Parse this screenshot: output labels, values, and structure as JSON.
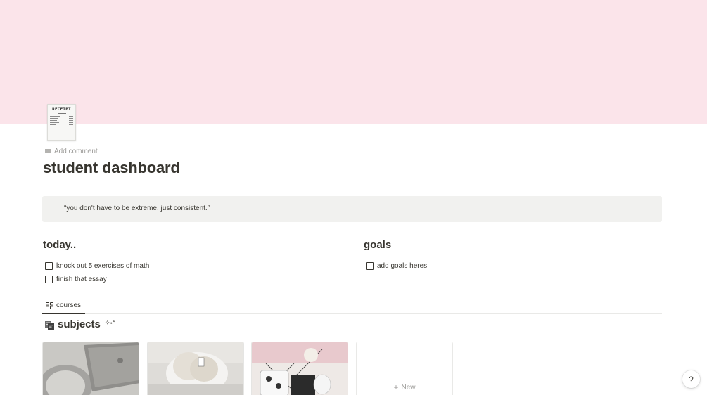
{
  "page": {
    "cover_color": "#fbe4ea",
    "icon": "receipt-icon",
    "icon_text": "RECEIPT",
    "add_comment": "Add comment",
    "title": "student dashboard"
  },
  "callout": {
    "quote": "“you don't have to be extreme. just consistent.”"
  },
  "today": {
    "heading": "today..",
    "items": [
      {
        "label": "knock out 5 exercises of math",
        "checked": false
      },
      {
        "label": "finish that essay",
        "checked": false
      }
    ]
  },
  "goals": {
    "heading": "goals",
    "items": [
      {
        "label": "add goals heres",
        "checked": false
      }
    ]
  },
  "database": {
    "tab_label": "courses",
    "tab_icon": "gallery-grid-icon",
    "title": "subjects",
    "title_suffix": "✧˖°",
    "title_icon": "books-icon",
    "new_label": "New"
  },
  "help": {
    "label": "?"
  }
}
